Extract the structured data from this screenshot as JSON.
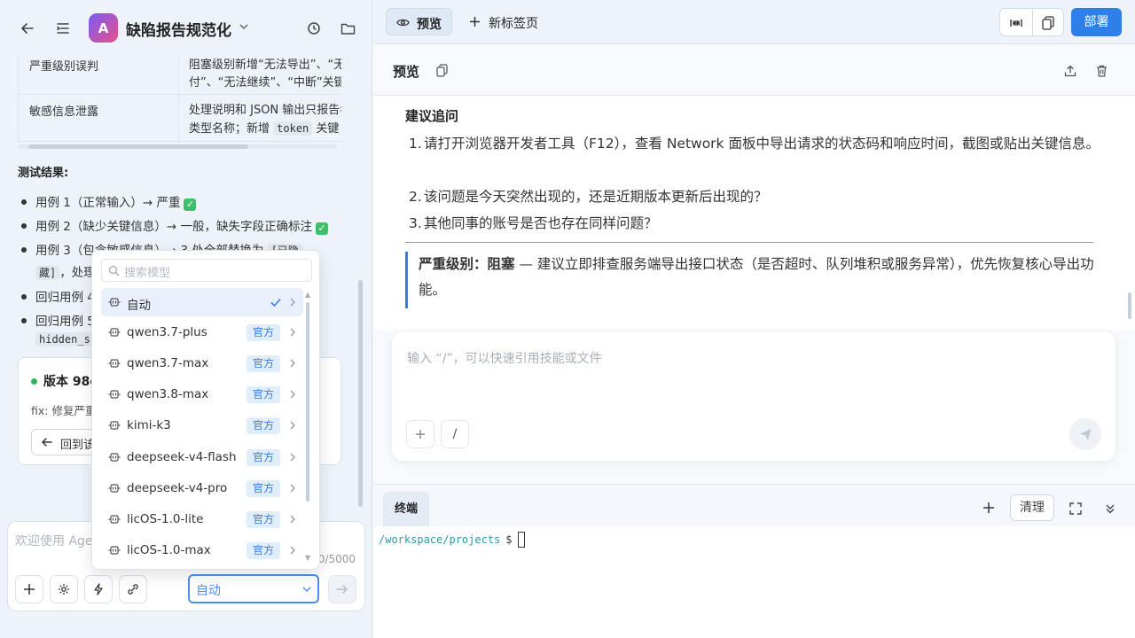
{
  "app": {
    "logo_letter": "A",
    "title": "缺陷报告规范化"
  },
  "table": {
    "rows": [
      {
        "c1": "严重级别误判",
        "c2a": "阻塞级别新增“无法导出”、“无",
        "c2b": "付”、“无法继续”、“中断”关键"
      },
      {
        "c1": "敏感信息泄露",
        "c2a": "处理说明和 JSON 输出只报告者",
        "c2b_pre": "类型名称；新增",
        "c2b_code": "token",
        "c2b_post": "关键"
      }
    ]
  },
  "results": {
    "heading": "测试结果:",
    "items": [
      "用例 1（正常输入）→ 严重",
      "用例 2（缺少关键信息）→ 一般，缺失字段正确标注",
      "用例 3（包含敏感信息）→ 3 处全部替换为",
      "回归用例 4",
      "回归用例 5"
    ],
    "item3_code": "[已隐",
    "item3_line2_code": "藏]",
    "item3_line2_text": "，处理",
    "item5_code": "hidden_s"
  },
  "version_card": {
    "title": "版本 98c",
    "desc": "fix: 修复严重",
    "rollback_label": "回到该"
  },
  "composer": {
    "placeholder": "欢迎使用 Agen",
    "char_count": "0/5000",
    "model_value": "自动"
  },
  "model_dropdown": {
    "search_placeholder": "搜索模型",
    "options": [
      {
        "name": "自动",
        "badge": "",
        "selected": true
      },
      {
        "name": "qwen3.7-plus",
        "badge": "官方",
        "selected": false
      },
      {
        "name": "qwen3.7-max",
        "badge": "官方",
        "selected": false
      },
      {
        "name": "qwen3.8-max",
        "badge": "官方",
        "selected": false
      },
      {
        "name": "kimi-k3",
        "badge": "官方",
        "selected": false
      },
      {
        "name": "deepseek-v4-flash",
        "badge": "官方",
        "selected": false
      },
      {
        "name": "deepseek-v4-pro",
        "badge": "官方",
        "selected": false
      },
      {
        "name": "licOS-1.0-lite",
        "badge": "官方",
        "selected": false
      },
      {
        "name": "licOS-1.0-max",
        "badge": "官方",
        "selected": false
      }
    ]
  },
  "tabs": {
    "preview": "预览",
    "new_tab": "新标签页"
  },
  "toolbar": {
    "deploy": "部署"
  },
  "preview": {
    "title": "预览",
    "suggestion_title": "建议追问",
    "list": [
      "请打开浏览器开发者工具（F12），查看 Network 面板中导出请求的状态码和响应时间，截图或贴出关键信息。",
      "该问题是今天突然出现的，还是近期版本更新后出现的？",
      "其他同事的账号是否也存在同样问题？"
    ],
    "callout_label": "严重级别：阻塞",
    "callout_text": " — 建议立即排查服务端导出接口状态（是否超时、队列堆积或服务异常），优先恢复核心导出功能。"
  },
  "chat": {
    "placeholder": "输入 “/”，可以快速引用技能或文件",
    "slash": "/"
  },
  "terminal": {
    "tab": "终端",
    "clear": "清理",
    "path": "/workspace/projects",
    "prompt": "$"
  },
  "colors": {
    "accent": "#2f7fe8",
    "badge_bg": "#e0edfb",
    "success": "#3cc06a"
  }
}
